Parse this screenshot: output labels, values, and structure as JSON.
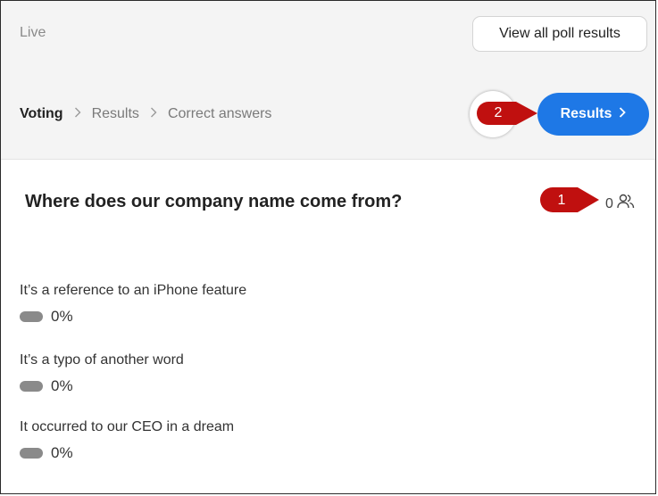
{
  "header": {
    "status": "Live",
    "view_all_label": "View all poll results"
  },
  "breadcrumb": {
    "items": [
      {
        "label": "Voting",
        "active": true
      },
      {
        "label": "Results",
        "active": false
      },
      {
        "label": "Correct answers",
        "active": false
      }
    ],
    "separator": ">"
  },
  "results_button": {
    "label": "Results",
    "chevron": ">"
  },
  "callouts": [
    {
      "number": "1",
      "color": "#c0100f"
    },
    {
      "number": "2",
      "color": "#c0100f"
    }
  ],
  "question": {
    "text": "Where does our company name come from?",
    "voter_count": "0",
    "voter_icon": "people-icon"
  },
  "options": [
    {
      "label": "It’s a reference to an iPhone feature",
      "percent": "0%"
    },
    {
      "label": "It’s a typo of another word",
      "percent": "0%"
    },
    {
      "label": "It occurred to our CEO in a dream",
      "percent": "0%"
    }
  ],
  "colors": {
    "accent": "#1e78e6",
    "background": "#f4f4f4",
    "callout": "#c0100f",
    "bar": "#8a8a8a"
  }
}
